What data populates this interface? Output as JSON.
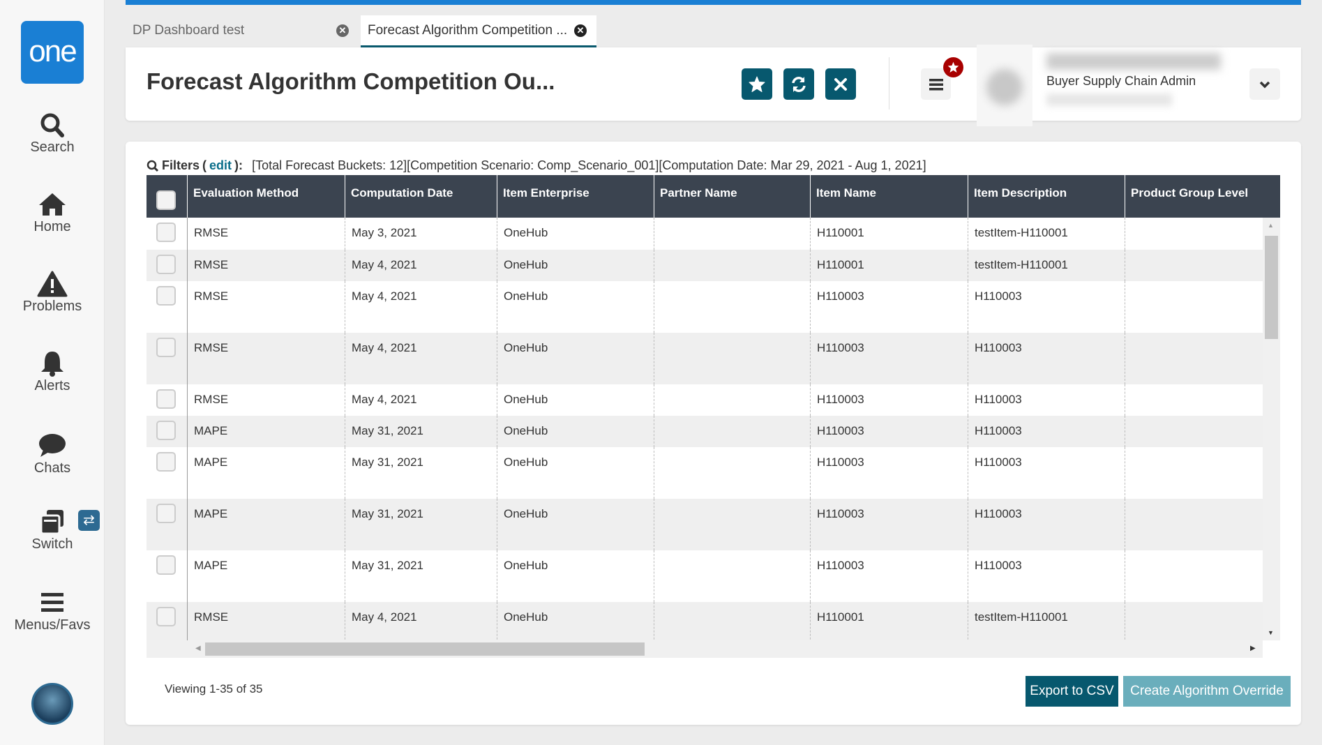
{
  "logo": "one",
  "sidebar": {
    "items": [
      {
        "label": "Search",
        "icon": "search-icon"
      },
      {
        "label": "Home",
        "icon": "home-icon"
      },
      {
        "label": "Problems",
        "icon": "warning-icon"
      },
      {
        "label": "Alerts",
        "icon": "bell-icon"
      },
      {
        "label": "Chats",
        "icon": "chat-icon"
      },
      {
        "label": "Switch",
        "icon": "switch-icon"
      },
      {
        "label": "Menus/Favs",
        "icon": "menu-icon"
      }
    ]
  },
  "tabs": [
    {
      "label": "DP Dashboard test"
    },
    {
      "label": "Forecast Algorithm Competition ..."
    }
  ],
  "header": {
    "title": "Forecast Algorithm Competition Ou...",
    "role": "Buyer Supply Chain Admin"
  },
  "filters": {
    "label": "Filters",
    "edit": "edit",
    "text": "[Total Forecast Buckets: 12][Competition Scenario: Comp_Scenario_001][Computation Date: Mar 29, 2021 - Aug 1, 2021]"
  },
  "table": {
    "columns": [
      "Evaluation Method",
      "Computation Date",
      "Item Enterprise",
      "Partner Name",
      "Item Name",
      "Item Description",
      "Product Group Level"
    ],
    "rows": [
      [
        "RMSE",
        "May 3, 2021",
        "OneHub",
        "",
        "H110001",
        "testItem-H110001",
        ""
      ],
      [
        "RMSE",
        "May 4, 2021",
        "OneHub",
        "",
        "H110001",
        "testItem-H110001",
        ""
      ],
      [
        "RMSE",
        "May 4, 2021",
        "OneHub",
        "",
        "H110003",
        "H110003",
        ""
      ],
      [
        "RMSE",
        "May 4, 2021",
        "OneHub",
        "",
        "H110003",
        "H110003",
        ""
      ],
      [
        "RMSE",
        "May 4, 2021",
        "OneHub",
        "",
        "H110003",
        "H110003",
        ""
      ],
      [
        "MAPE",
        "May 31, 2021",
        "OneHub",
        "",
        "H110003",
        "H110003",
        ""
      ],
      [
        "MAPE",
        "May 31, 2021",
        "OneHub",
        "",
        "H110003",
        "H110003",
        ""
      ],
      [
        "MAPE",
        "May 31, 2021",
        "OneHub",
        "",
        "H110003",
        "H110003",
        ""
      ],
      [
        "MAPE",
        "May 31, 2021",
        "OneHub",
        "",
        "H110003",
        "H110003",
        ""
      ],
      [
        "RMSE",
        "May 4, 2021",
        "OneHub",
        "",
        "H110001",
        "testItem-H110001",
        ""
      ]
    ]
  },
  "footer": {
    "viewing": "Viewing 1-35 of 35",
    "export": "Export to CSV",
    "create": "Create Algorithm Override"
  }
}
